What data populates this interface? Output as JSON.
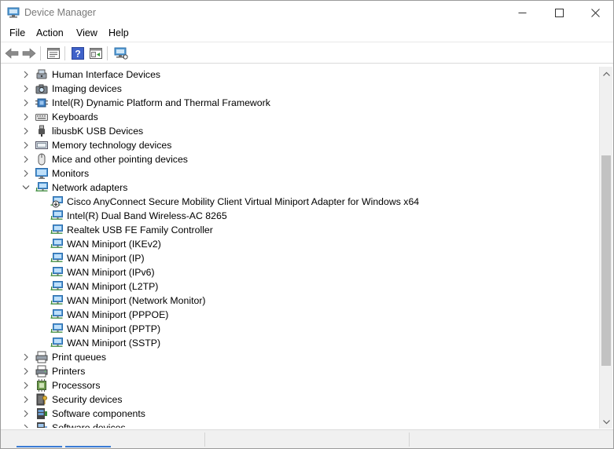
{
  "window": {
    "title": "Device Manager",
    "controls": {
      "minimize": "minimize",
      "maximize": "maximize",
      "close": "close"
    }
  },
  "menu": [
    "File",
    "Action",
    "View",
    "Help"
  ],
  "toolbar": [
    "back-icon",
    "forward-icon",
    "properties-icon",
    "help-icon",
    "show-hide-icon",
    "scan-hardware-icon"
  ],
  "tree": {
    "items": [
      {
        "label": "Human Interface Devices",
        "level": 0,
        "expanded": false,
        "icon": "hid-icon"
      },
      {
        "label": "Imaging devices",
        "level": 0,
        "expanded": false,
        "icon": "camera-icon"
      },
      {
        "label": "Intel(R) Dynamic Platform and Thermal Framework",
        "level": 0,
        "expanded": false,
        "icon": "chip-icon"
      },
      {
        "label": "Keyboards",
        "level": 0,
        "expanded": false,
        "icon": "keyboard-icon"
      },
      {
        "label": "libusbK USB Devices",
        "level": 0,
        "expanded": false,
        "icon": "usb-icon"
      },
      {
        "label": "Memory technology devices",
        "level": 0,
        "expanded": false,
        "icon": "memory-icon"
      },
      {
        "label": "Mice and other pointing devices",
        "level": 0,
        "expanded": false,
        "icon": "mouse-icon"
      },
      {
        "label": "Monitors",
        "level": 0,
        "expanded": false,
        "icon": "monitor-icon"
      },
      {
        "label": "Network adapters",
        "level": 0,
        "expanded": true,
        "icon": "network-icon"
      },
      {
        "label": "Cisco AnyConnect Secure Mobility Client Virtual Miniport Adapter for Windows x64",
        "level": 1,
        "icon": "network-disabled-icon"
      },
      {
        "label": "Intel(R) Dual Band Wireless-AC 8265",
        "level": 1,
        "icon": "network-icon"
      },
      {
        "label": "Realtek USB FE Family Controller",
        "level": 1,
        "icon": "network-icon"
      },
      {
        "label": "WAN Miniport (IKEv2)",
        "level": 1,
        "icon": "network-icon"
      },
      {
        "label": "WAN Miniport (IP)",
        "level": 1,
        "icon": "network-icon"
      },
      {
        "label": "WAN Miniport (IPv6)",
        "level": 1,
        "icon": "network-icon"
      },
      {
        "label": "WAN Miniport (L2TP)",
        "level": 1,
        "icon": "network-icon"
      },
      {
        "label": "WAN Miniport (Network Monitor)",
        "level": 1,
        "icon": "network-icon"
      },
      {
        "label": "WAN Miniport (PPPOE)",
        "level": 1,
        "icon": "network-icon"
      },
      {
        "label": "WAN Miniport (PPTP)",
        "level": 1,
        "icon": "network-icon"
      },
      {
        "label": "WAN Miniport (SSTP)",
        "level": 1,
        "icon": "network-icon"
      },
      {
        "label": "Print queues",
        "level": 0,
        "expanded": false,
        "icon": "print-queue-icon"
      },
      {
        "label": "Printers",
        "level": 0,
        "expanded": false,
        "icon": "printer-icon"
      },
      {
        "label": "Processors",
        "level": 0,
        "expanded": false,
        "icon": "processor-icon"
      },
      {
        "label": "Security devices",
        "level": 0,
        "expanded": false,
        "icon": "security-icon"
      },
      {
        "label": "Software components",
        "level": 0,
        "expanded": false,
        "icon": "software-component-icon"
      },
      {
        "label": "Software devices",
        "level": 0,
        "expanded": false,
        "icon": "software-device-icon"
      }
    ]
  },
  "colors": {
    "accent": "#3a7bd5",
    "selection": "#cce8ff",
    "scroll_thumb": "#c2c2c2"
  }
}
